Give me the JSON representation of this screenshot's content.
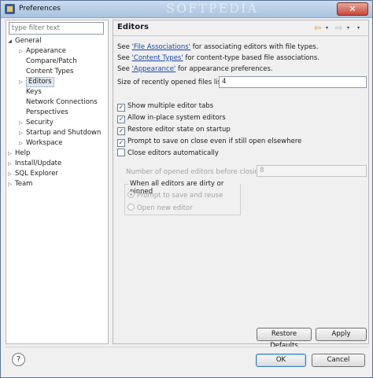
{
  "window": {
    "title": "Preferences",
    "watermark": "SOFTPEDIA"
  },
  "filter": {
    "placeholder": "type filter text"
  },
  "tree": [
    {
      "label": "General",
      "level": 0,
      "expanded": true
    },
    {
      "label": "Appearance",
      "level": 1,
      "expandable": true
    },
    {
      "label": "Compare/Patch",
      "level": 1
    },
    {
      "label": "Content Types",
      "level": 1
    },
    {
      "label": "Editors",
      "level": 1,
      "expandable": true,
      "selected": true
    },
    {
      "label": "Keys",
      "level": 1
    },
    {
      "label": "Network Connections",
      "level": 1
    },
    {
      "label": "Perspectives",
      "level": 1
    },
    {
      "label": "Security",
      "level": 1,
      "expandable": true
    },
    {
      "label": "Startup and Shutdown",
      "level": 1,
      "expandable": true
    },
    {
      "label": "Workspace",
      "level": 1,
      "expandable": true
    },
    {
      "label": "Help",
      "level": 0,
      "expandable": true
    },
    {
      "label": "Install/Update",
      "level": 0,
      "expandable": true
    },
    {
      "label": "SQL Explorer",
      "level": 0,
      "expandable": true
    },
    {
      "label": "Team",
      "level": 0,
      "expandable": true
    }
  ],
  "page": {
    "title": "Editors",
    "links": [
      {
        "prefix": "See ",
        "link": "'File Associations'",
        "suffix": " for associating editors with file types."
      },
      {
        "prefix": "See ",
        "link": "'Content Types'",
        "suffix": " for content-type based file associations."
      },
      {
        "prefix": "See ",
        "link": "'Appearance'",
        "suffix": " for appearance preferences."
      }
    ],
    "recent_files_label": "Size of recently opened files list:",
    "recent_files_value": "4",
    "checkboxes": [
      {
        "label": "Show multiple editor tabs",
        "checked": true
      },
      {
        "label": "Allow in-place system editors",
        "checked": true
      },
      {
        "label": "Restore editor state on startup",
        "checked": true
      },
      {
        "label": "Prompt to save on close even if still open elsewhere",
        "checked": true
      },
      {
        "label": "Close editors automatically",
        "checked": false
      }
    ],
    "close_count_label": "Number of opened editors before closing:",
    "close_count_value": "8",
    "dirty_group_title": "When all editors are dirty or pinned",
    "radios": [
      {
        "label": "Prompt to save and reuse",
        "selected": true
      },
      {
        "label": "Open new editor",
        "selected": false
      }
    ],
    "restore_defaults": "Restore Defaults",
    "apply": "Apply"
  },
  "footer": {
    "ok": "OK",
    "cancel": "Cancel"
  },
  "icons": {
    "back": "arrow-left-icon",
    "forward": "arrow-right-icon",
    "menu": "view-menu-icon",
    "help": "help-icon",
    "check_glyph": "✓",
    "expanded_glyph": "◢",
    "collapsed_glyph": "▷",
    "back_glyph": "⇦",
    "forward_glyph": "⇨",
    "dropdown_glyph": "▾",
    "help_glyph": "?",
    "close_glyph": "✕"
  },
  "colors": {
    "link": "#1b47a8",
    "title_bar": "#bcd3ea",
    "selection": "#dfe7f1"
  }
}
